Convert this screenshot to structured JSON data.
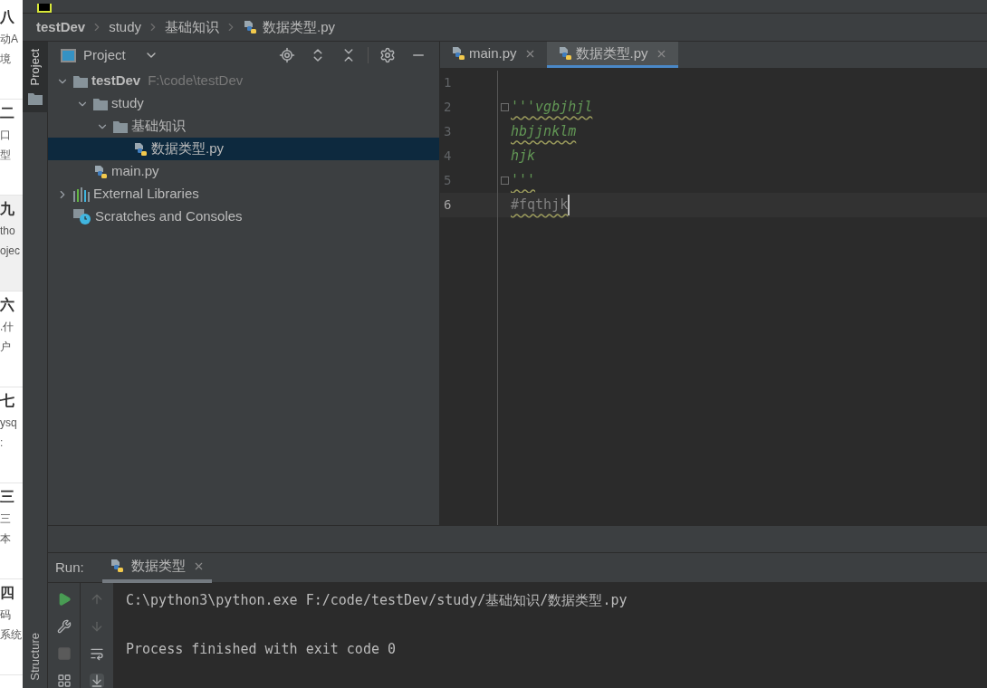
{
  "browser_strip": {
    "items": [
      {
        "title": "八",
        "lines": [
          "动A",
          "境"
        ],
        "selected": false
      },
      {
        "title": "二",
        "lines": [
          "口",
          "型"
        ],
        "selected": false
      },
      {
        "title": "九",
        "lines": [
          "tho",
          "ojec"
        ],
        "selected": true
      },
      {
        "title": "六",
        "lines": [
          ".什",
          "户"
        ],
        "selected": false
      },
      {
        "title": "七",
        "lines": [
          "ysq",
          ":"
        ],
        "selected": false
      },
      {
        "title": "三",
        "lines": [
          "三",
          "本"
        ],
        "selected": false
      },
      {
        "title": "四",
        "lines": [
          "码",
          "系统"
        ],
        "selected": false
      }
    ]
  },
  "breadcrumb": [
    {
      "label": "testDev",
      "kind": "project"
    },
    {
      "label": "study",
      "kind": "folder"
    },
    {
      "label": "基础知识",
      "kind": "folder"
    },
    {
      "label": "数据类型.py",
      "kind": "python"
    }
  ],
  "tool_stripe": {
    "top": [
      {
        "label": "Project",
        "selected": true
      }
    ],
    "bottom": [
      {
        "label": "Structure",
        "selected": false
      }
    ]
  },
  "project_panel": {
    "title": "Project",
    "tree": [
      {
        "label": "testDev",
        "hint": "F:\\code\\testDev",
        "kind": "root",
        "expanded": true,
        "selected": false,
        "children": [
          {
            "label": "study",
            "kind": "folder",
            "expanded": true,
            "selected": false,
            "children": [
              {
                "label": "基础知识",
                "kind": "folder",
                "expanded": true,
                "selected": false,
                "children": [
                  {
                    "label": "数据类型.py",
                    "kind": "python",
                    "selected": true
                  }
                ]
              }
            ]
          },
          {
            "label": "main.py",
            "kind": "python",
            "selected": false
          }
        ]
      },
      {
        "label": "External Libraries",
        "kind": "libraries",
        "expanded": false,
        "selected": false
      },
      {
        "label": "Scratches and Consoles",
        "kind": "scratches",
        "selected": false
      }
    ]
  },
  "editor": {
    "tabs": [
      {
        "label": "main.py",
        "selected": false
      },
      {
        "label": "数据类型.py",
        "selected": true
      }
    ],
    "lines": [
      {
        "number": "1",
        "current": false
      },
      {
        "number": "2",
        "text": "'''vgbjhjl",
        "kind": "docstring",
        "fold": true,
        "underlined": true,
        "current": false
      },
      {
        "number": "3",
        "text": "hbjjnklm",
        "kind": "docstring",
        "fold": false,
        "underlined": true,
        "current": false
      },
      {
        "number": "4",
        "text": "hjk",
        "kind": "docstring",
        "fold": false,
        "underlined": false,
        "current": false
      },
      {
        "number": "5",
        "text": "'''",
        "kind": "docstring",
        "fold": true,
        "underlined": true,
        "current": false
      },
      {
        "number": "6",
        "text": "#fqthjk",
        "kind": "comment",
        "fold": false,
        "underlined": true,
        "current": true
      }
    ]
  },
  "run_panel": {
    "label": "Run:",
    "tabs": [
      {
        "label": "数据类型",
        "selected": true
      }
    ],
    "output": [
      {
        "text": "C:\\python3\\python.exe F:/code/testDev/study/基础知识/数据类型.py",
        "kind": "command"
      },
      {
        "text": "Process finished with exit code 0",
        "kind": "status"
      }
    ]
  }
}
